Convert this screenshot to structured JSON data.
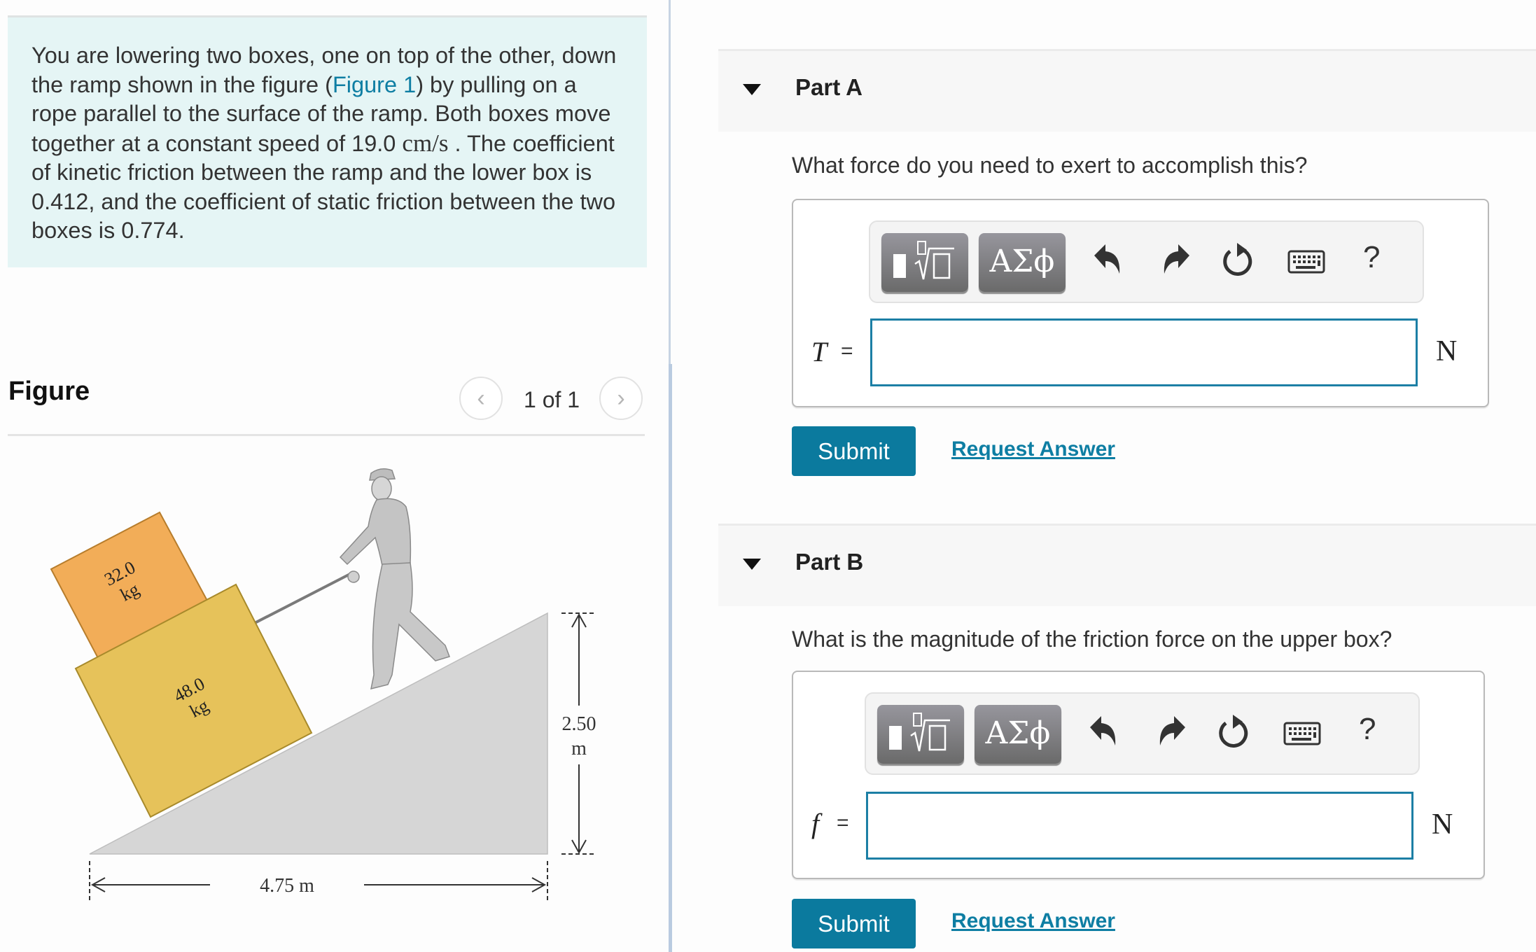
{
  "problem": {
    "text_before_link": "You are lowering two boxes, one on top of the other, down the ramp shown in the figure (",
    "figure_link": "Figure 1",
    "text_after_link": ") by pulling on a rope parallel to the surface of the ramp. Both boxes move together at a constant speed of 19.0 ",
    "speed_unit": "cm/s",
    "text_end": " . The coefficient of kinetic friction between the ramp and the lower box is 0.412, and the coefficient of static friction between the two boxes is 0.774."
  },
  "figure": {
    "title": "Figure",
    "pager": {
      "prev_icon": "chevron-left-icon",
      "next_icon": "chevron-right-icon",
      "prev": "‹",
      "next": "›",
      "count": "1 of 1"
    },
    "upper_box": {
      "mass": "32.0",
      "unit": "kg",
      "color": "#f2ad58"
    },
    "lower_box": {
      "mass": "48.0",
      "unit": "kg",
      "color": "#e6c25a"
    },
    "height_label": {
      "value": "2.50",
      "unit": "m"
    },
    "base_label": "4.75 m",
    "ramp_color": "#d6d6d6"
  },
  "parts": [
    {
      "title": "Part A",
      "question": "What force do you need to exert to accomplish this?",
      "variable": "T",
      "equals": "=",
      "input_value": "",
      "unit": "N",
      "toolbar": {
        "templates_icon": "fraction-root-template-icon",
        "greek_label": "ΑΣϕ",
        "undo_icon": "undo-icon",
        "redo_icon": "redo-icon",
        "reset_icon": "reset-icon",
        "keyboard_icon": "keyboard-icon",
        "help_label": "?"
      },
      "submit_label": "Submit",
      "request_label": "Request Answer"
    },
    {
      "title": "Part B",
      "question": "What is the magnitude of the friction force on the upper box?",
      "variable": "f",
      "equals": "=",
      "input_value": "",
      "unit": "N",
      "toolbar": {
        "templates_icon": "fraction-root-template-icon",
        "greek_label": "ΑΣϕ",
        "undo_icon": "undo-icon",
        "redo_icon": "redo-icon",
        "reset_icon": "reset-icon",
        "keyboard_icon": "keyboard-icon",
        "help_label": "?"
      },
      "submit_label": "Submit",
      "request_label": "Request Answer"
    }
  ],
  "colors": {
    "accent": "#0b7a9e",
    "link": "#0e7ea3",
    "problem_bg": "#e5f5f5",
    "input_border": "#1c7fa5"
  }
}
